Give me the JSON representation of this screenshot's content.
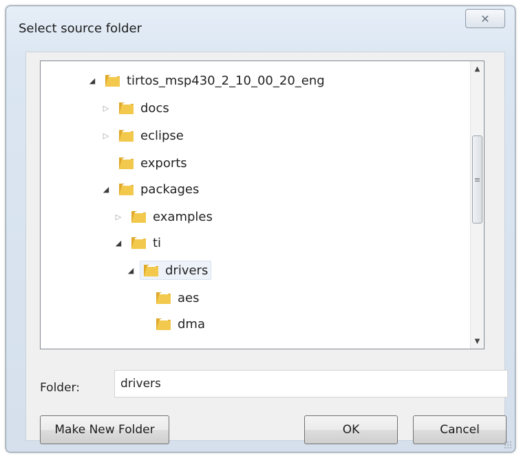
{
  "dialog": {
    "title": "Select source folder",
    "close_glyph": "✕"
  },
  "tree": {
    "nodes": [
      {
        "label": "tirtos_msp430_2_10_00_20_eng",
        "state": "expanded"
      },
      {
        "label": "docs",
        "state": "collapsed"
      },
      {
        "label": "eclipse",
        "state": "collapsed"
      },
      {
        "label": "exports",
        "state": "leaf"
      },
      {
        "label": "packages",
        "state": "expanded"
      },
      {
        "label": "examples",
        "state": "collapsed"
      },
      {
        "label": "ti",
        "state": "expanded"
      },
      {
        "label": "drivers",
        "state": "expanded",
        "selected": true
      },
      {
        "label": "aes",
        "state": "leaf"
      },
      {
        "label": "dma",
        "state": "leaf"
      }
    ],
    "scroll_up_glyph": "▲",
    "scroll_down_glyph": "▼",
    "thumb_glyph": "≡"
  },
  "folder_field": {
    "label": "Folder:",
    "value": "drivers"
  },
  "buttons": {
    "make_new_folder": "Make New Folder",
    "ok": "OK",
    "cancel": "Cancel"
  },
  "icons": {
    "expanded_arrow": "◢",
    "collapsed_arrow": "▷",
    "folder": "folder-icon"
  },
  "colors": {
    "folder_front": "#f2c94c",
    "folder_back": "#e0a92a",
    "selection": "#eef3fa"
  }
}
